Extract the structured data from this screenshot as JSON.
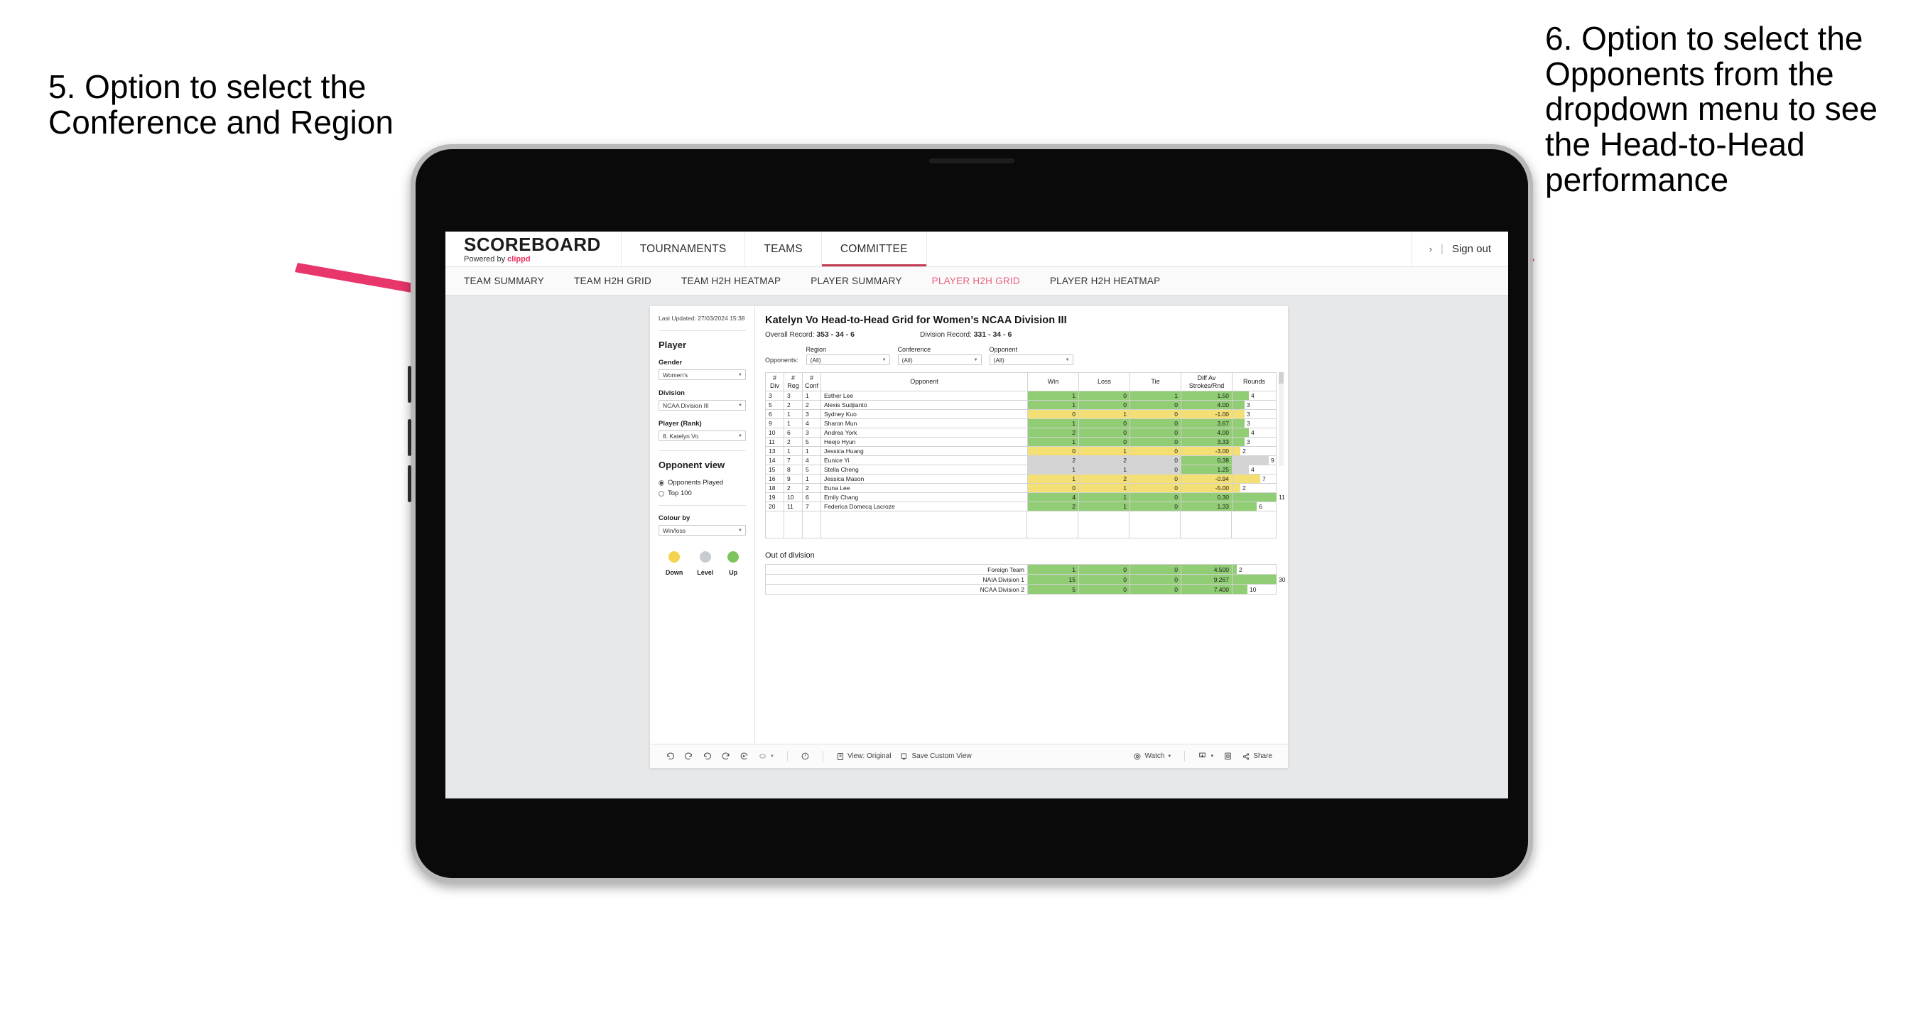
{
  "annotations": {
    "left": "5. Option to select the Conference and Region",
    "right": "6. Option to select the Opponents from the dropdown menu to see the Head-to-Head performance"
  },
  "colors": {
    "accent_pink": "#e8305e",
    "active_tab": "#e8607f",
    "up_green": "#91cd74",
    "down_yellow": "#f4df75",
    "level_grey": "#d4d4d4"
  },
  "app": {
    "brand": {
      "name": "SCOREBOARD",
      "powered_prefix": "Powered by ",
      "powered_by": "clippd"
    },
    "topnav": [
      {
        "label": "TOURNAMENTS",
        "active": false
      },
      {
        "label": "TEAMS",
        "active": false
      },
      {
        "label": "COMMITTEE",
        "active": true
      }
    ],
    "account": {
      "chevron": "›",
      "divider": "|",
      "sign_out": "Sign out"
    },
    "subnav": [
      {
        "label": "TEAM SUMMARY",
        "active": false
      },
      {
        "label": "TEAM H2H GRID",
        "active": false
      },
      {
        "label": "TEAM H2H HEATMAP",
        "active": false
      },
      {
        "label": "PLAYER SUMMARY",
        "active": false
      },
      {
        "label": "PLAYER H2H GRID",
        "active": true
      },
      {
        "label": "PLAYER H2H HEATMAP",
        "active": false
      }
    ]
  },
  "sidebar": {
    "last_updated": "Last Updated: 27/03/2024 15:38",
    "player_section_title": "Player",
    "fields": [
      {
        "label": "Gender",
        "value": "Women’s"
      },
      {
        "label": "Division",
        "value": "NCAA Division III"
      },
      {
        "label": "Player (Rank)",
        "value": "8. Katelyn Vo"
      }
    ],
    "opponent_view": {
      "title": "Opponent view",
      "options": [
        {
          "label": "Opponents Played",
          "selected": true
        },
        {
          "label": "Top 100",
          "selected": false
        }
      ]
    },
    "colour_by": {
      "label": "Colour by",
      "value": "Win/loss"
    },
    "legend": [
      {
        "label": "Down",
        "color": "#f4d34f"
      },
      {
        "label": "Level",
        "color": "#c8cbd0"
      },
      {
        "label": "Up",
        "color": "#7dc45c"
      }
    ]
  },
  "viz": {
    "title": "Katelyn Vo Head-to-Head Grid for Women’s NCAA Division III",
    "overall_record_label": "Overall Record:",
    "overall_record_value": "353 - 34 - 6",
    "division_record_label": "Division Record:",
    "division_record_value": "331 - 34 - 6",
    "opponents_label": "Opponents:",
    "filters": [
      {
        "label": "Region",
        "value": "(All)"
      },
      {
        "label": "Conference",
        "value": "(All)"
      },
      {
        "label": "Opponent",
        "value": "(All)"
      }
    ]
  },
  "chart_data": {
    "type": "table",
    "title": "Katelyn Vo Head-to-Head Grid for Women’s NCAA Division III",
    "columns": [
      "# Div",
      "# Reg",
      "# Conf",
      "Opponent",
      "Win",
      "Loss",
      "Tie",
      "Diff Av Strokes/Rnd",
      "Rounds"
    ],
    "column_headers_multiline": [
      [
        "#",
        "Div"
      ],
      [
        "#",
        "Reg"
      ],
      [
        "#",
        "Conf"
      ],
      [
        "Opponent"
      ],
      [
        "Win"
      ],
      [
        "Loss"
      ],
      [
        "Tie"
      ],
      [
        "Diff Av",
        "Strokes/Rnd"
      ],
      [
        "Rounds"
      ]
    ],
    "rounds_max": 11,
    "rows": [
      {
        "div": "3",
        "reg": "3",
        "conf": "1",
        "opponent": "Esther Lee",
        "win": "1",
        "loss": "0",
        "tie": "1",
        "diff": "1.50",
        "rounds": "4",
        "rounds_n": 4,
        "color": "g"
      },
      {
        "div": "5",
        "reg": "2",
        "conf": "2",
        "opponent": "Alexis Sudjianto",
        "win": "1",
        "loss": "0",
        "tie": "0",
        "diff": "4.00",
        "rounds": "3",
        "rounds_n": 3,
        "color": "g"
      },
      {
        "div": "6",
        "reg": "1",
        "conf": "3",
        "opponent": "Sydney Kuo",
        "win": "0",
        "loss": "1",
        "tie": "0",
        "diff": "-1.00",
        "rounds": "3",
        "rounds_n": 3,
        "color": "y"
      },
      {
        "div": "9",
        "reg": "1",
        "conf": "4",
        "opponent": "Sharon Mun",
        "win": "1",
        "loss": "0",
        "tie": "0",
        "diff": "3.67",
        "rounds": "3",
        "rounds_n": 3,
        "color": "g"
      },
      {
        "div": "10",
        "reg": "6",
        "conf": "3",
        "opponent": "Andrea York",
        "win": "2",
        "loss": "0",
        "tie": "0",
        "diff": "4.00",
        "rounds": "4",
        "rounds_n": 4,
        "color": "g"
      },
      {
        "div": "11",
        "reg": "2",
        "conf": "5",
        "opponent": "Heejo Hyun",
        "win": "1",
        "loss": "0",
        "tie": "0",
        "diff": "3.33",
        "rounds": "3",
        "rounds_n": 3,
        "color": "g"
      },
      {
        "div": "13",
        "reg": "1",
        "conf": "1",
        "opponent": "Jessica Huang",
        "win": "0",
        "loss": "1",
        "tie": "0",
        "diff": "-3.00",
        "rounds": "2",
        "rounds_n": 2,
        "color": "y"
      },
      {
        "div": "14",
        "reg": "7",
        "conf": "4",
        "opponent": "Eunice Yi",
        "win": "2",
        "loss": "2",
        "tie": "0",
        "diff": "0.38",
        "rounds": "9",
        "rounds_n": 9,
        "color": "s",
        "diff_color": "g"
      },
      {
        "div": "15",
        "reg": "8",
        "conf": "5",
        "opponent": "Stella Cheng",
        "win": "1",
        "loss": "1",
        "tie": "0",
        "diff": "1.25",
        "rounds": "4",
        "rounds_n": 4,
        "color": "s",
        "diff_color": "g"
      },
      {
        "div": "16",
        "reg": "9",
        "conf": "1",
        "opponent": "Jessica Mason",
        "win": "1",
        "loss": "2",
        "tie": "0",
        "diff": "-0.94",
        "rounds": "7",
        "rounds_n": 7,
        "color": "y"
      },
      {
        "div": "18",
        "reg": "2",
        "conf": "2",
        "opponent": "Euna Lee",
        "win": "0",
        "loss": "1",
        "tie": "0",
        "diff": "-5.00",
        "rounds": "2",
        "rounds_n": 2,
        "color": "y"
      },
      {
        "div": "19",
        "reg": "10",
        "conf": "6",
        "opponent": "Emily Chang",
        "win": "4",
        "loss": "1",
        "tie": "0",
        "diff": "0.30",
        "rounds": "11",
        "rounds_n": 11,
        "color": "g"
      },
      {
        "div": "20",
        "reg": "11",
        "conf": "7",
        "opponent": "Federica Domecq Lacroze",
        "win": "2",
        "loss": "1",
        "tie": "0",
        "diff": "1.33",
        "rounds": "6",
        "rounds_n": 6,
        "color": "g"
      }
    ],
    "out_of_division": {
      "title": "Out of division",
      "rounds_max": 30,
      "rows": [
        {
          "name": "Foreign Team",
          "win": "1",
          "loss": "0",
          "tie": "0",
          "diff": "4.500",
          "rounds": "2",
          "rounds_n": 2,
          "color": "g"
        },
        {
          "name": "NAIA Division 1",
          "win": "15",
          "loss": "0",
          "tie": "0",
          "diff": "9.267",
          "rounds": "30",
          "rounds_n": 30,
          "color": "g"
        },
        {
          "name": "NCAA Division 2",
          "win": "5",
          "loss": "0",
          "tie": "0",
          "diff": "7.400",
          "rounds": "10",
          "rounds_n": 10,
          "color": "g"
        }
      ]
    }
  },
  "toolbar": {
    "view_label": "View: Original",
    "save_label": "Save Custom View",
    "watch_label": "Watch",
    "share_label": "Share"
  }
}
